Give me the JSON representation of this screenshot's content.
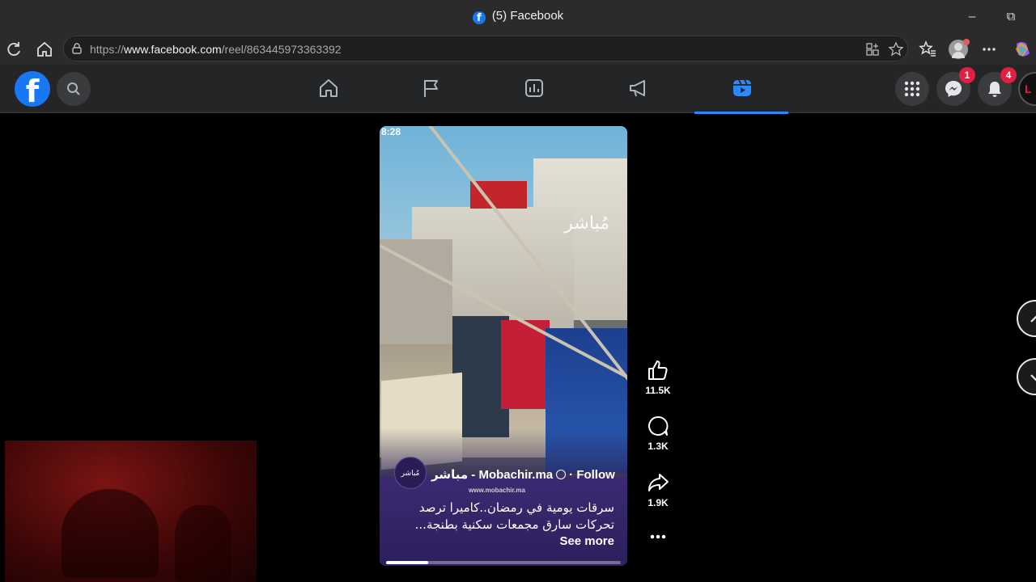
{
  "window": {
    "title": "(5) Facebook",
    "minimize": "–",
    "restore": "⧉"
  },
  "browser": {
    "url_prefix": "https://",
    "url_domain": "www.facebook.com",
    "url_path": "/reel/863445973363392"
  },
  "fb_header": {
    "logo": "f",
    "messenger_badge": "1",
    "notifications_badge": "4",
    "profile_initial": "L"
  },
  "reel": {
    "timestamp": "8:28",
    "watermark": "مُباشر",
    "page_avatar_text": "مُباشر",
    "page_name": "مباشر - Mobachir.ma",
    "follow_label": "· Follow",
    "site": "www.mobachir.ma",
    "caption": "سرقات يومية في رمضان..كاميرا ترصد تحركات سارق مجمعات سكنية بطنجة...",
    "see_more": "See more",
    "progress": 0.18
  },
  "actions": {
    "likes": "11.5K",
    "comments": "1.3K",
    "shares": "1.9K"
  },
  "colors": {
    "brand": "#1877f2",
    "badge": "#e41e3f",
    "active_tab": "#2d88ff"
  }
}
